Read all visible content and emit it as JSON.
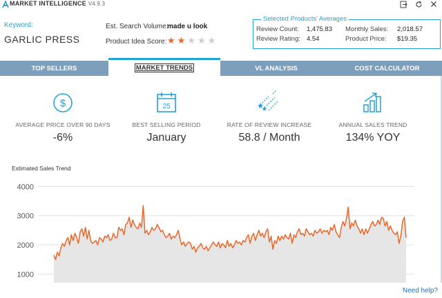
{
  "app": {
    "title": "MARKET INTELLIGENCE",
    "version": "V4.9.3"
  },
  "keyword": {
    "label": "Keyword:",
    "value": "GARLIC PRESS"
  },
  "est_search_volume": {
    "label": "Est. Search Volume:",
    "value": "made u look"
  },
  "product_idea_score": {
    "label": "Product Idea Score:",
    "rating": 2,
    "max": 5
  },
  "averages": {
    "title": "Selected Products' Averages",
    "review_count_label": "Review Count:",
    "review_count": "1,475.83",
    "review_rating_label": "Review Rating:",
    "review_rating": "4.54",
    "monthly_sales_label": "Monthly Sales:",
    "monthly_sales": "2,018.57",
    "product_price_label": "Product Price:",
    "product_price": "$19.35"
  },
  "tabs": [
    {
      "label": "TOP SELLERS",
      "active": false
    },
    {
      "label": "MARKET TRENDS",
      "active": true
    },
    {
      "label": "VL ANALYSIS",
      "active": false
    },
    {
      "label": "COST CALCULATOR",
      "active": false
    }
  ],
  "stats": [
    {
      "icon": "dollar-icon",
      "label": "AVERAGE PRICE OVER 90 DAYS",
      "value": "-6%"
    },
    {
      "icon": "calendar-icon",
      "label": "BEST SELLING PERIOD",
      "value": "January",
      "calendar_day": "25"
    },
    {
      "icon": "shooting-stars-icon",
      "label": "RATE OF REVIEW INCREASE",
      "value": "58.8 / Month"
    },
    {
      "icon": "growth-chart-icon",
      "label": "ANNUAL SALES TREND",
      "value": "134% YOY"
    }
  ],
  "chart_title": "Estimated Sales Trend",
  "help_link": "Need help?",
  "colors": {
    "accent": "#22a3d6",
    "tab_bar": "#7e9fbb",
    "line": "#e8672a",
    "area": "#e6e6e6",
    "star": "#e8672a",
    "star_empty": "#cccccc"
  },
  "chart_data": {
    "type": "area",
    "title": "Estimated Sales Trend",
    "ylim": [
      700,
      4200
    ],
    "yticks": [
      1000,
      2000,
      3000,
      4000
    ],
    "grid": true,
    "legend": false,
    "values": [
      1650,
      1500,
      1750,
      1620,
      1900,
      2050,
      1950,
      2150,
      2250,
      2000,
      2350,
      2150,
      2400,
      2250,
      2050,
      2450,
      2550,
      2300,
      2600,
      2200,
      2500,
      2150,
      2050,
      2100,
      2150,
      2000,
      2250,
      2200,
      2100,
      2300,
      2250,
      2350,
      2150,
      2200,
      2400,
      2250,
      2250,
      2600,
      2500,
      2550,
      2350,
      2700,
      2750,
      2950,
      2600,
      2850,
      2700,
      2600,
      2550,
      2750,
      2600,
      3350,
      2400,
      2500,
      2350,
      2450,
      2600,
      2500,
      2550,
      2700,
      2600,
      2450,
      2500,
      2350,
      2250,
      2300,
      2400,
      2200,
      2300,
      2250,
      2350,
      2500,
      2200,
      2000,
      2100,
      1950,
      2050,
      2100,
      2050,
      1850,
      1950,
      1750,
      1900,
      1950,
      2050,
      1900,
      1850,
      1950,
      1800,
      1900,
      2000,
      2100,
      2000,
      1950,
      2100,
      1900,
      2050,
      2000,
      1900,
      2150,
      1950,
      2050,
      1900,
      2000,
      2150,
      2050,
      2100,
      2000,
      2150,
      2100,
      2250,
      2350,
      2050,
      2300,
      2400,
      2150,
      2350,
      2500,
      2300,
      2400,
      2250,
      2450,
      2550,
      2100,
      2300,
      1850,
      2150,
      2050,
      2300,
      2150,
      2300,
      2200,
      2350,
      2250,
      2200,
      2400,
      2050,
      2350,
      2250,
      2450,
      2550,
      2350,
      2400,
      2300,
      2550,
      2450,
      2350,
      2400,
      2300,
      2500,
      2400,
      2450,
      2550,
      2400,
      2500,
      2450,
      2500,
      2350,
      2600,
      2500,
      2700,
      2450,
      2350,
      2250,
      2600,
      2800,
      2650,
      2900,
      3300,
      2550,
      2750,
      2650,
      2850,
      2650,
      2550,
      2400,
      2550,
      2350,
      2550,
      2400,
      2550,
      2700,
      2800,
      2650,
      2700,
      2850,
      2700,
      2950,
      2900,
      2650,
      2800,
      2500,
      2650,
      2500,
      2400,
      2350,
      2450,
      2050,
      2300,
      2800,
      2950,
      2250
    ]
  }
}
